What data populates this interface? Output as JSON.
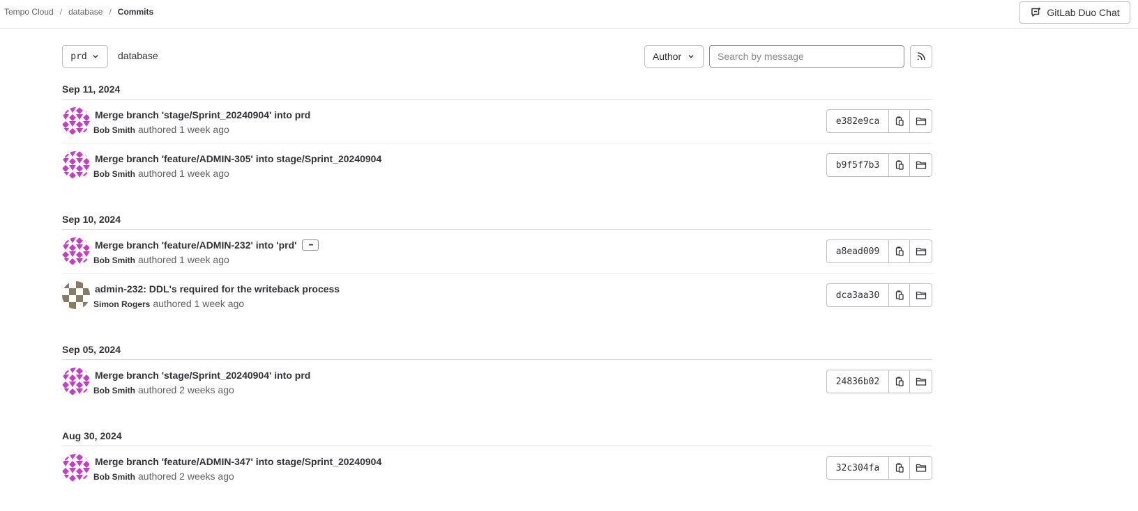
{
  "breadcrumb": {
    "items": [
      "Tempo Cloud",
      "database"
    ],
    "current": "Commits",
    "separator": "/"
  },
  "header": {
    "duo_chat_label": "GitLab Duo Chat"
  },
  "filters": {
    "ref": "prd",
    "path": "database",
    "author_label": "Author",
    "search_placeholder": "Search by message"
  },
  "days": [
    {
      "date": "Sep 11, 2024",
      "commits": [
        {
          "title": "Merge branch 'stage/Sprint_20240904' into prd",
          "author": "Bob Smith",
          "verb": "authored",
          "when": "1 week ago",
          "sha": "e382e9ca",
          "avatar": "bob"
        },
        {
          "title": "Merge branch 'feature/ADMIN-305' into stage/Sprint_20240904",
          "author": "Bob Smith",
          "verb": "authored",
          "when": "1 week ago",
          "sha": "b9f5f7b3",
          "avatar": "bob"
        }
      ]
    },
    {
      "date": "Sep 10, 2024",
      "commits": [
        {
          "title": "Merge branch 'feature/ADMIN-232' into 'prd'",
          "author": "Bob Smith",
          "verb": "authored",
          "when": "1 week ago",
          "sha": "a8ead009",
          "avatar": "bob",
          "has_description": true
        },
        {
          "title": "admin-232: DDL's required for the writeback process",
          "author": "Simon Rogers",
          "verb": "authored",
          "when": "1 week ago",
          "sha": "dca3aa30",
          "avatar": "simon"
        }
      ]
    },
    {
      "date": "Sep 05, 2024",
      "commits": [
        {
          "title": "Merge branch 'stage/Sprint_20240904' into prd",
          "author": "Bob Smith",
          "verb": "authored",
          "when": "2 weeks ago",
          "sha": "24836b02",
          "avatar": "bob"
        }
      ]
    },
    {
      "date": "Aug 30, 2024",
      "commits": [
        {
          "title": "Merge branch 'feature/ADMIN-347' into stage/Sprint_20240904",
          "author": "Bob Smith",
          "verb": "authored",
          "when": "2 weeks ago",
          "sha": "32c304fa",
          "avatar": "bob"
        }
      ]
    }
  ],
  "icons": {
    "ref_dropdown": "chevron-down-icon",
    "rss": "rss-icon",
    "copy": "copy-to-clipboard-icon",
    "browse": "folder-icon",
    "duo": "duo-chat-icon",
    "more": "ellipsis-icon"
  },
  "colors": {
    "avatar_bob": "#c53dc6",
    "avatar_simon": "#8b7b64",
    "border": "#bfbfc3",
    "text": "#333238",
    "muted": "#626168"
  }
}
